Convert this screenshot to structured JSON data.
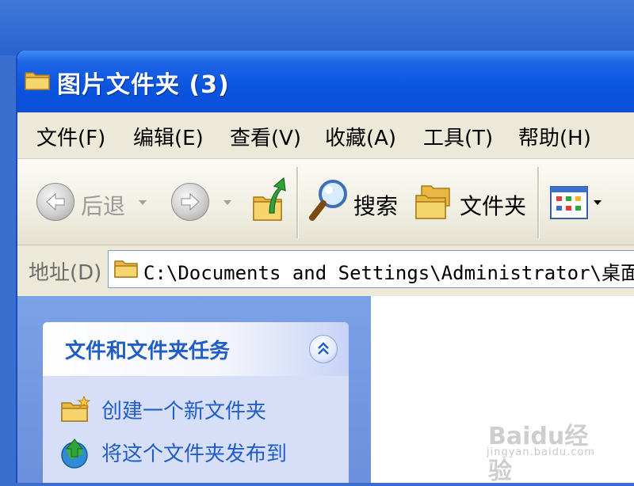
{
  "window": {
    "title": "图片文件夹 (3)"
  },
  "menu": {
    "items": [
      "文件(F)",
      "编辑(E)",
      "查看(V)",
      "收藏(A)",
      "工具(T)",
      "帮助(H)"
    ]
  },
  "toolbar": {
    "back_label": "后退",
    "search_label": "搜索",
    "folders_label": "文件夹"
  },
  "address": {
    "label": "地址(D)",
    "path": "C:\\Documents and Settings\\Administrator\\桌面\\图片"
  },
  "taskpane": {
    "section_title": "文件和文件夹任务",
    "items": [
      {
        "label": "创建一个新文件夹",
        "icon": "new-folder-icon"
      },
      {
        "label": "将这个文件夹发布到",
        "icon": "publish-web-icon"
      }
    ]
  },
  "watermark": {
    "brand": "Baidu经验",
    "url": "jingyan.baidu.com"
  },
  "colors": {
    "titlebar": "#0a54e0",
    "taskpane_bg": "#7ba2e7",
    "task_link": "#215dc6"
  }
}
